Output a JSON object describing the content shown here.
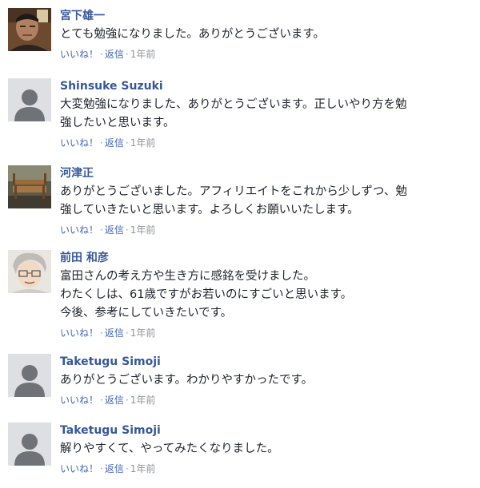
{
  "comments": [
    {
      "author": "宮下雄一",
      "avatar": "profile-photo-man",
      "lines": [
        "とても勉強になりました。ありがとうございます。"
      ],
      "like": "いいね！",
      "reply": "返信",
      "time": "1年前"
    },
    {
      "author": "Shinsuke Suzuki",
      "avatar": "default-avatar",
      "lines": [
        "大変勉強になりました、ありがとうございます。正しいやり方を勉",
        "強したいと思います。"
      ],
      "like": "いいね！",
      "reply": "返信",
      "time": "1年前"
    },
    {
      "author": "河津正",
      "avatar": "profile-photo-bench",
      "lines": [
        "ありがとうございました。アフィリエイトをこれから少しずつ、勉",
        "強していきたいと思います。よろしくお願いいたします。"
      ],
      "like": "いいね！",
      "reply": "返信",
      "time": "1年前"
    },
    {
      "author": "前田 和彦",
      "avatar": "profile-illustration-man",
      "lines": [
        "富田さんの考え方や生き方に感銘を受けました。",
        "わたくしは、61歳ですがお若いのにすごいと思います。",
        "今後、参考にしていきたいです。"
      ],
      "like": "いいね！",
      "reply": "返信",
      "time": "1年前"
    },
    {
      "author": "Taketugu Simoji",
      "avatar": "default-avatar",
      "lines": [
        "ありがとうございます。わかりやすかったです。"
      ],
      "like": "いいね！",
      "reply": "返信",
      "time": "1年前"
    },
    {
      "author": "Taketugu Simoji",
      "avatar": "default-avatar",
      "lines": [
        "解りやすくて、やってみたくなりました。"
      ],
      "like": "いいね！",
      "reply": "返信",
      "time": "1年前"
    }
  ],
  "colors": {
    "author": "#365899",
    "link": "#4267b2",
    "meta": "#90949c",
    "text": "#1d2129",
    "default_avatar_bg": "#dddfe2",
    "default_avatar_fg": "#6f7276"
  }
}
